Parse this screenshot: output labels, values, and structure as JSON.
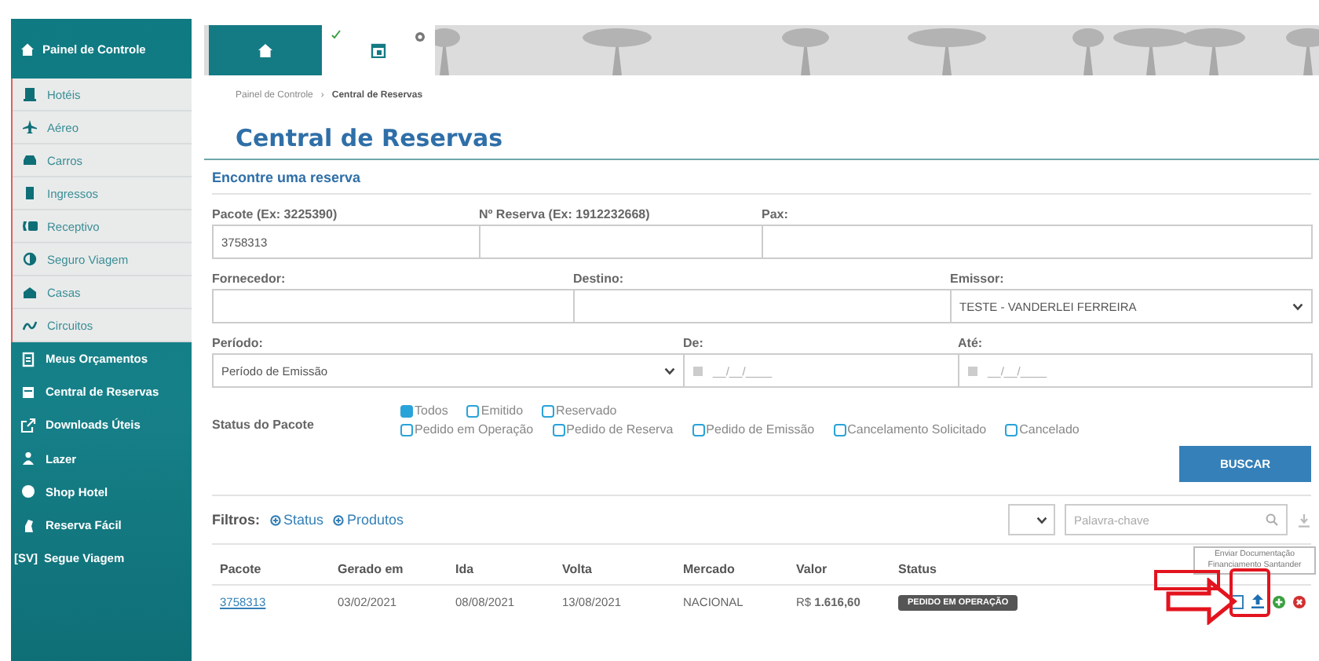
{
  "sidebar": {
    "header": "Painel de Controle",
    "products": [
      {
        "label": "Hotéis"
      },
      {
        "label": "Aéreo"
      },
      {
        "label": "Carros"
      },
      {
        "label": "Ingressos"
      },
      {
        "label": "Receptivo"
      },
      {
        "label": "Seguro Viagem"
      },
      {
        "label": "Casas"
      },
      {
        "label": "Circuitos"
      }
    ],
    "tools": [
      {
        "label": "Meus Orçamentos"
      },
      {
        "label": "Central de Reservas"
      },
      {
        "label": "Downloads Úteis"
      },
      {
        "label": "Lazer"
      },
      {
        "label": "Shop Hotel"
      },
      {
        "label": "Reserva Fácil"
      },
      {
        "label": "Segue Viagem",
        "icon_text": "[SV]"
      }
    ]
  },
  "tabs": [
    {
      "kind": "home",
      "selected": false
    },
    {
      "kind": "page",
      "selected": true
    }
  ],
  "breadcrumb": [
    "Painel de Controle",
    "›",
    "Central de Reservas"
  ],
  "title": "Central de Reservas",
  "search": {
    "heading": "Encontre uma reserva",
    "fields": [
      {
        "label": "Pacote (Ex: 3225390)",
        "value": "3758313",
        "kind": "text"
      },
      {
        "label": "Nº Reserva (Ex: 1912232668)",
        "kind": "text"
      },
      {
        "label": "Pax:",
        "kind": "text"
      },
      {
        "label": "Fornecedor:",
        "kind": "text"
      },
      {
        "label": "Destino:",
        "kind": "text"
      },
      {
        "label": "Emissor:",
        "value": "TESTE - VANDERLEI FERREIRA",
        "kind": "select"
      },
      {
        "label": "Período:",
        "value": "Período de Emissão",
        "kind": "select"
      },
      {
        "label": "De:",
        "placeholder": "__/__/____",
        "kind": "date"
      },
      {
        "label": "Até:",
        "placeholder": "__/__/____",
        "kind": "date"
      }
    ],
    "status_label": "Status do Pacote",
    "status_options": [
      {
        "label": "Todos",
        "checked": true
      },
      {
        "label": "Emitido",
        "checked": false
      },
      {
        "label": "Reservado",
        "checked": false
      },
      {
        "label": "Pedido em Operação",
        "checked": false
      },
      {
        "label": "Pedido de Reserva",
        "checked": false
      },
      {
        "label": "Pedido de Emissão",
        "checked": false
      },
      {
        "label": "Cancelamento Solicitado",
        "checked": false
      },
      {
        "label": "Cancelado",
        "checked": false
      }
    ],
    "button": "BUSCAR"
  },
  "filters": {
    "label": "Filtros:",
    "links": [
      "Status",
      "Produtos"
    ],
    "keyword_placeholder": "Palavra-chave"
  },
  "table": {
    "columns": [
      "Pacote",
      "Gerado em",
      "Ida",
      "Volta",
      "Mercado",
      "Valor",
      "Status"
    ],
    "rows": [
      {
        "pacote": "3758313",
        "gerado_em": "03/02/2021",
        "ida": "08/08/2021",
        "volta": "13/08/2021",
        "mercado": "NACIONAL",
        "valor_currency": "R$",
        "valor": "1.616,60",
        "status": "PEDIDO EM OPERAÇÃO"
      }
    ]
  },
  "tooltip": "Enviar Documentação Financiamento Santander"
}
